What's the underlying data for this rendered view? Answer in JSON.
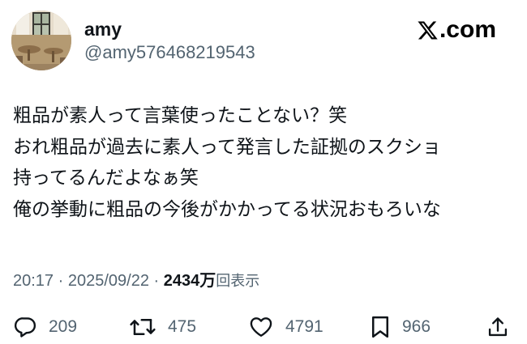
{
  "author": {
    "display_name": "amy",
    "handle": "@amy576468219543"
  },
  "brand": {
    "name": ".com",
    "logo_icon": "x-logo-icon"
  },
  "tweet": {
    "lines": [
      "粗品が素人って言葉使ったことない？笑",
      "おれ粗品が過去に素人って発言した証拠のスクショ",
      "持ってるんだよなぁ笑",
      "俺の挙動に粗品の今後がかかってる状況おもろいな"
    ]
  },
  "meta": {
    "time": "20:17",
    "separator1": " · ",
    "date": "2025/09/22",
    "separator2": " · ",
    "views_count": "2434万",
    "views_label": "回表示"
  },
  "actions": {
    "reply": {
      "icon": "reply-icon",
      "count": "209"
    },
    "repost": {
      "icon": "repost-icon",
      "count": "475"
    },
    "like": {
      "icon": "heart-icon",
      "count": "4791"
    },
    "bookmark": {
      "icon": "bookmark-icon",
      "count": "966"
    },
    "share": {
      "icon": "share-icon"
    }
  },
  "colors": {
    "text_primary": "#0f1419",
    "text_secondary": "#536471",
    "background": "#ffffff"
  }
}
